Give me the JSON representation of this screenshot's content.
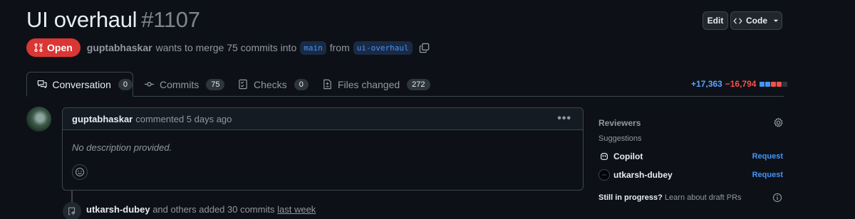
{
  "header": {
    "title": "UI overhaul",
    "number": "#1107",
    "edit_label": "Edit",
    "code_label": "Code"
  },
  "meta": {
    "state": "Open",
    "author": "guptabhaskar",
    "text1": "wants to merge 75 commits into",
    "base_branch": "main",
    "text2": "from",
    "head_branch": "ui-overhaul"
  },
  "tabs": [
    {
      "label": "Conversation",
      "count": "0",
      "icon": "comment-discussion-icon"
    },
    {
      "label": "Commits",
      "count": "75",
      "icon": "git-commit-icon"
    },
    {
      "label": "Checks",
      "count": "0",
      "icon": "checklist-icon"
    },
    {
      "label": "Files changed",
      "count": "272",
      "icon": "file-diff-icon"
    }
  ],
  "diffstat": {
    "additions": "+17,363",
    "deletions": "−16,794",
    "colors": [
      "#4493f8",
      "#4493f8",
      "#f85149",
      "#f85149",
      "#2f353d"
    ]
  },
  "comment": {
    "author": "guptabhaskar",
    "action": "commented 5 days ago",
    "body": "No description provided."
  },
  "event": {
    "author": "utkarsh-dubey",
    "text": "and others added 30 commits",
    "time": "last week"
  },
  "sidebar": {
    "reviewers_heading": "Reviewers",
    "suggestions_label": "Suggestions",
    "reviewers": [
      {
        "name": "Copilot",
        "action": "Request"
      },
      {
        "name": "utkarsh-dubey",
        "action": "Request"
      }
    ],
    "draft_bold": "Still in progress?",
    "draft_text": "Learn about draft PRs"
  },
  "colors": {
    "background": "#0d1117",
    "accent": "#4493f8",
    "open_state": "#da3633"
  }
}
